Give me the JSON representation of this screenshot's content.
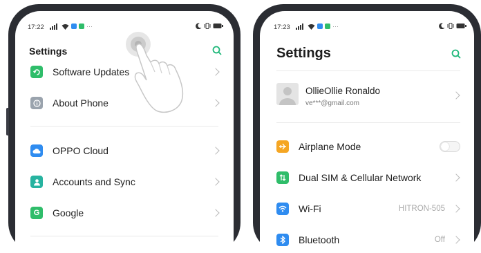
{
  "left_screen": {
    "status": {
      "time": "17:22",
      "left_icons": [
        "signal-icon",
        "wifi-icon",
        "app-badge-icon"
      ],
      "right_icons": [
        "moon-icon",
        "vibrate-icon",
        "battery-icon"
      ]
    },
    "title": "Settings",
    "items": [
      {
        "label": "Software Updates",
        "icon": "refresh-icon",
        "color": "#2fbd6a"
      },
      {
        "label": "About Phone",
        "icon": "info-icon",
        "color": "#9aa3ad"
      },
      {
        "label": "OPPO Cloud",
        "icon": "cloud-icon",
        "color": "#2f8cf0"
      },
      {
        "label": "Accounts and Sync",
        "icon": "person-icon",
        "color": "#27b3a0"
      },
      {
        "label": "Google",
        "icon": "google-icon",
        "color": "#2fbd6a"
      }
    ]
  },
  "right_screen": {
    "status": {
      "time": "17:23",
      "left_icons": [
        "signal-icon",
        "wifi-icon",
        "app-badge-icon"
      ],
      "right_icons": [
        "moon-icon",
        "vibrate-icon",
        "battery-icon"
      ]
    },
    "title": "Settings",
    "account": {
      "name": "OllieOllie Ronaldo",
      "email": "ve***@gmail.com"
    },
    "items": [
      {
        "label": "Airplane Mode",
        "icon": "airplane-icon",
        "color": "#f5a623",
        "toggle_on": false
      },
      {
        "label": "Dual SIM & Cellular Network",
        "icon": "sim-icon",
        "color": "#2fbd6a"
      },
      {
        "label": "Wi-Fi",
        "icon": "wifi-icon",
        "color": "#2f8cf0",
        "value": "HITRON-505"
      },
      {
        "label": "Bluetooth",
        "icon": "bluetooth-icon",
        "color": "#2f8cf0",
        "value": "Off"
      }
    ]
  }
}
